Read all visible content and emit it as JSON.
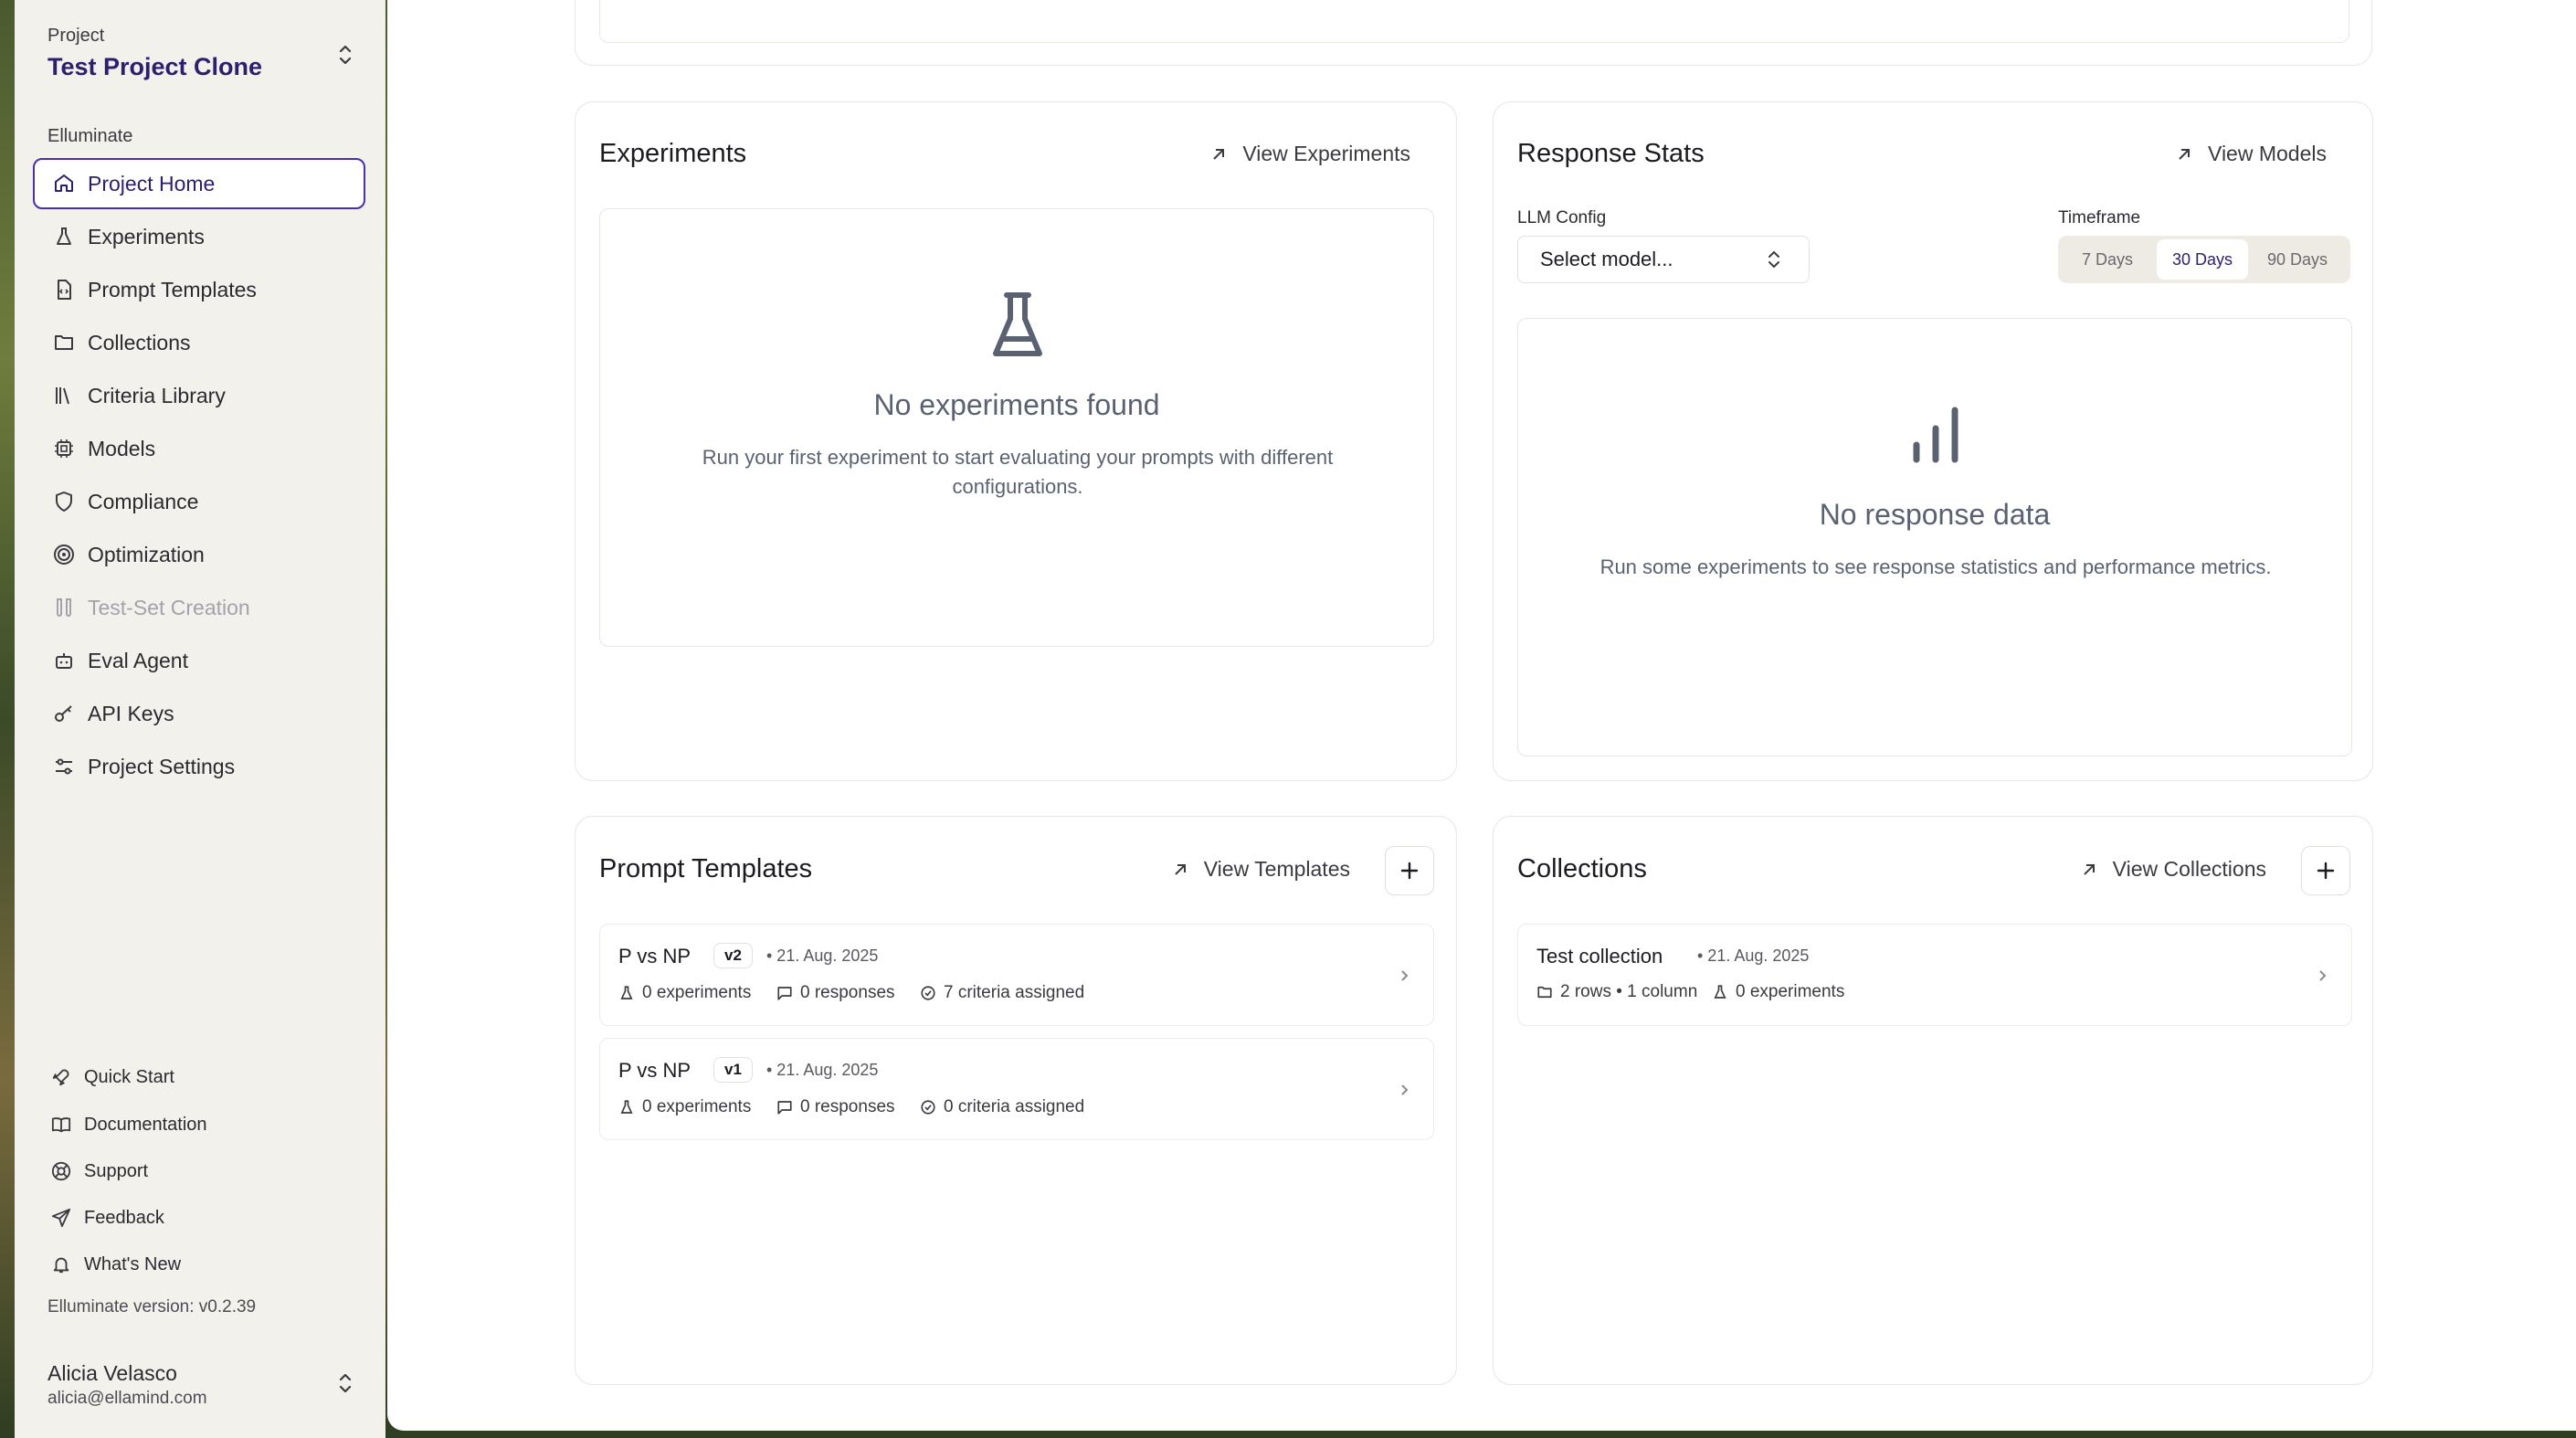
{
  "sidebar": {
    "project_label": "Project",
    "project_name": "Test Project Clone",
    "section_label": "Elluminate",
    "items": [
      {
        "label": "Project Home",
        "icon": "home-icon"
      },
      {
        "label": "Experiments",
        "icon": "flask-icon"
      },
      {
        "label": "Prompt Templates",
        "icon": "file-code-icon"
      },
      {
        "label": "Collections",
        "icon": "folder-icon"
      },
      {
        "label": "Criteria Library",
        "icon": "library-icon"
      },
      {
        "label": "Models",
        "icon": "cpu-icon"
      },
      {
        "label": "Compliance",
        "icon": "shield-icon"
      },
      {
        "label": "Optimization",
        "icon": "target-icon"
      },
      {
        "label": "Test-Set Creation",
        "icon": "test-tubes-icon"
      },
      {
        "label": "Eval Agent",
        "icon": "bot-icon"
      },
      {
        "label": "API Keys",
        "icon": "key-icon"
      },
      {
        "label": "Project Settings",
        "icon": "settings-icon"
      }
    ],
    "footer_items": [
      {
        "label": "Quick Start",
        "icon": "rocket-icon"
      },
      {
        "label": "Documentation",
        "icon": "book-icon"
      },
      {
        "label": "Support",
        "icon": "life-buoy-icon"
      },
      {
        "label": "Feedback",
        "icon": "send-icon"
      },
      {
        "label": "What's New",
        "icon": "bell-icon"
      }
    ],
    "version": "Elluminate version: v0.2.39",
    "user_name": "Alicia Velasco",
    "user_email": "alicia@ellamind.com"
  },
  "experiments": {
    "title": "Experiments",
    "link": "View Experiments",
    "empty_title": "No experiments found",
    "empty_desc": "Run your first experiment to start evaluating your prompts with different configurations."
  },
  "response_stats": {
    "title": "Response Stats",
    "link": "View Models",
    "llm_label": "LLM Config",
    "select_placeholder": "Select model...",
    "timeframe_label": "Timeframe",
    "timeframes": [
      "7 Days",
      "30 Days",
      "90 Days"
    ],
    "selected_timeframe": "30 Days",
    "empty_title": "No response data",
    "empty_desc": "Run some experiments to see response statistics and performance metrics."
  },
  "prompt_templates": {
    "title": "Prompt Templates",
    "link": "View Templates",
    "rows": [
      {
        "name": "P vs NP",
        "version": "v2",
        "date": "• 21. Aug. 2025",
        "experiments": "0 experiments",
        "responses": "0 responses",
        "criteria": "7 criteria assigned"
      },
      {
        "name": "P vs NP",
        "version": "v1",
        "date": "• 21. Aug. 2025",
        "experiments": "0 experiments",
        "responses": "0 responses",
        "criteria": "0 criteria assigned"
      }
    ]
  },
  "collections": {
    "title": "Collections",
    "link": "View Collections",
    "rows": [
      {
        "name": "Test collection",
        "date": "• 21. Aug. 2025",
        "size": "2 rows • 1 column",
        "experiments": "0 experiments"
      }
    ]
  },
  "colors": {
    "accent": "#2d1f6e",
    "active_border": "#4b2fa8",
    "empty_text": "#5a6272"
  }
}
